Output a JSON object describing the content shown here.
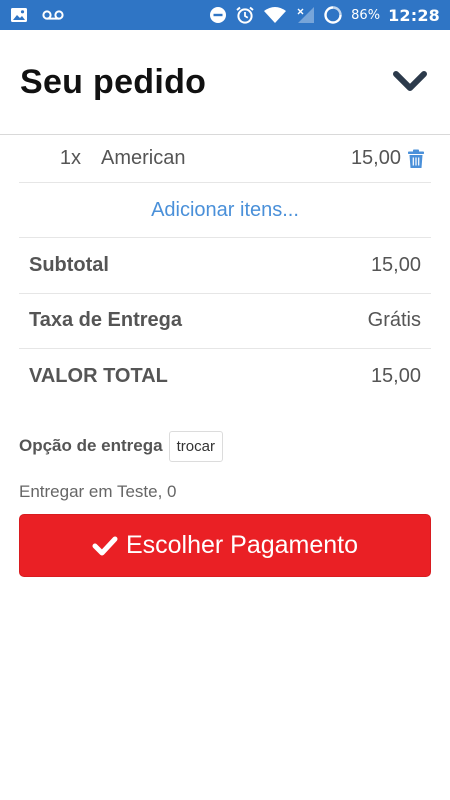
{
  "status_bar": {
    "battery": "86%",
    "time": "12:28",
    "icons": [
      "image-icon",
      "voicemail-icon",
      "do-not-disturb-icon",
      "alarm-icon",
      "wifi-icon",
      "signal-icon",
      "battery-icon"
    ]
  },
  "header": {
    "title": "Seu pedido",
    "collapse_icon": "chevron-down-icon"
  },
  "items": [
    {
      "qty": "1x",
      "name": "American",
      "price": "15,00",
      "icon": "trash-icon"
    }
  ],
  "add_items_label": "Adicionar itens...",
  "summary": {
    "subtotal_label": "Subtotal",
    "subtotal_value": "15,00",
    "fee_label": "Taxa de Entrega",
    "fee_value": "Grátis",
    "total_label": "VALOR TOTAL",
    "total_value": "15,00"
  },
  "delivery": {
    "label": "Opção de entrega",
    "change_label": "trocar",
    "address": "Entregar em Teste, 0"
  },
  "payment_button": {
    "label": "Escolher Pagamento",
    "icon": "check-icon"
  },
  "colors": {
    "status_bar": "#2f75c5",
    "link": "#4a90d9",
    "primary_button": "#ea2025"
  }
}
